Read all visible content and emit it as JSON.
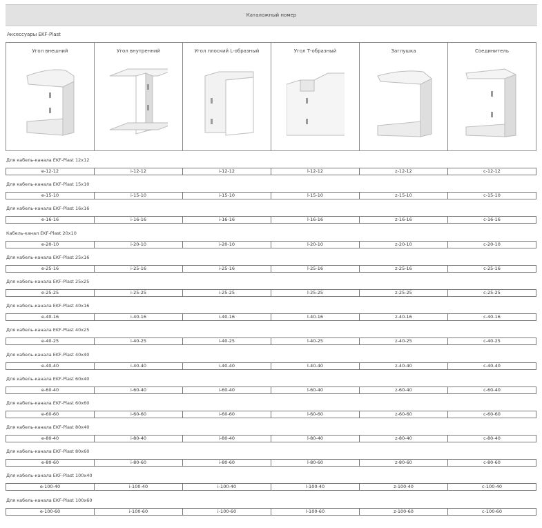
{
  "header": {
    "title": "Каталожный номер"
  },
  "subtitle": "Аксессуары EKF-Plast",
  "products": [
    {
      "name": "Угол внешний",
      "icon": "external-corner-image"
    },
    {
      "name": "Угол внутренний",
      "icon": "internal-corner-image"
    },
    {
      "name": "Угол плоский L-образный",
      "icon": "flat-l-corner-image"
    },
    {
      "name": "Угол Т-образный",
      "icon": "t-corner-image"
    },
    {
      "name": "Заглушка",
      "icon": "end-cap-image"
    },
    {
      "name": "Соединитель",
      "icon": "connector-image"
    }
  ],
  "sections": [
    {
      "label": "Для кабель-канала EKF-Plast 12х12",
      "codes": [
        "e-12-12",
        "i-12-12",
        "i-12-12",
        "l-12-12",
        "z-12-12",
        "c-12-12"
      ]
    },
    {
      "label": "Для кабель-канала EKF-Plast 15х10",
      "codes": [
        "e-15-10",
        "i-15-10",
        "i-15-10",
        "l-15-10",
        "z-15-10",
        "c-15-10"
      ]
    },
    {
      "label": "Для кабель-канала EKF-Plast 16х16",
      "codes": [
        "e-16-16",
        "i-16-16",
        "i-16-16",
        "l-16-16",
        "z-16-16",
        "c-16-16"
      ]
    },
    {
      "label": "Кабель-канал EKF-Plast 20х10",
      "codes": [
        "e-20-10",
        "i-20-10",
        "i-20-10",
        "l-20-10",
        "z-20-10",
        "c-20-10"
      ]
    },
    {
      "label": "Для кабель-канала EKF-Plast 25х16",
      "codes": [
        "e-25-16",
        "i-25-16",
        "i-25-16",
        "l-25-16",
        "z-25-16",
        "c-25-16"
      ]
    },
    {
      "label": "Для кабель-канала EKF-Plast 25х25",
      "codes": [
        "e-25-25",
        "i-25-25",
        "i-25-25",
        "l-25-25",
        "z-25-25",
        "c-25-25"
      ]
    },
    {
      "label": "Для кабель-канала EKF-Plast 40х16",
      "codes": [
        "e-40-16",
        "i-40-16",
        "i-40-16",
        "l-40-16",
        "z-40-16",
        "c-40-16"
      ]
    },
    {
      "label": "Для кабель-канала EKF-Plast 40х25",
      "codes": [
        "e-40-25",
        "i-40-25",
        "i-40-25",
        "l-40-25",
        "z-40-25",
        "c-40-25"
      ]
    },
    {
      "label": "Для кабель-канала EKF-Plast 40х40",
      "codes": [
        "e-40-40",
        "i-40-40",
        "i-40-40",
        "l-40-40",
        "z-40-40",
        "c-40-40"
      ]
    },
    {
      "label": "Для кабель-канала EKF-Plast 60х40",
      "codes": [
        "e-60-40",
        "i-60-40",
        "i-60-40",
        "l-60-40",
        "z-60-40",
        "c-60-40"
      ]
    },
    {
      "label": "Для кабель-канала EKF-Plast 60х60",
      "codes": [
        "e-60-60",
        "i-60-60",
        "i-60-60",
        "l-60-60",
        "z-60-60",
        "c-60-60"
      ]
    },
    {
      "label": "Для кабель-канала EKF-Plast 80х40",
      "codes": [
        "e-80-40",
        "i-80-40",
        "i-80-40",
        "l-80-40",
        "z-80-40",
        "c-80-40"
      ]
    },
    {
      "label": "Для кабель-канала EKF-Plast 80х60",
      "codes": [
        "e-80-60",
        "i-80-60",
        "i-80-60",
        "l-80-60",
        "z-80-60",
        "c-80-60"
      ]
    },
    {
      "label": "Для кабель-канала EKF-Plast 100х40",
      "codes": [
        "e-100-40",
        "i-100-40",
        "i-100-40",
        "l-100-40",
        "z-100-40",
        "c-100-40"
      ]
    },
    {
      "label": "Для кабель-канала EKF-Plast 100х60",
      "codes": [
        "e-100-60",
        "i-100-60",
        "i-100-60",
        "l-100-60",
        "z-100-60",
        "c-100-60"
      ]
    }
  ]
}
